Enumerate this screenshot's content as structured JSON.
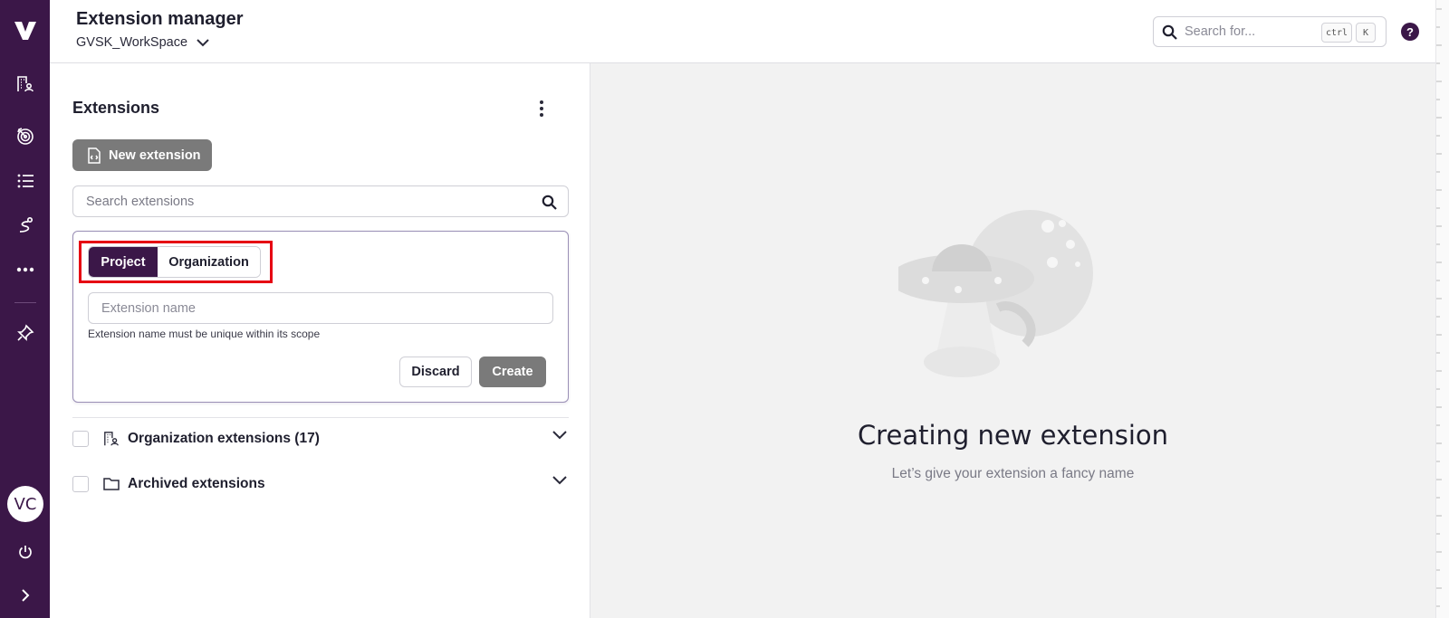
{
  "app": {
    "title": "Extension manager",
    "workspace": "GVSK_WorkSpace"
  },
  "rail": {
    "logo": "V",
    "items": [
      {
        "icon": "building-person-icon"
      },
      {
        "icon": "target-icon"
      },
      {
        "icon": "list-icon"
      },
      {
        "icon": "route-icon"
      },
      {
        "icon": "more-horizontal-icon"
      },
      {
        "icon": "pin-icon"
      }
    ],
    "avatar_initials": "VC",
    "power_icon": "power-icon",
    "expand_icon": "chevron-right-icon"
  },
  "header": {
    "search_placeholder": "Search for...",
    "shortcut_key_1": "ctrl",
    "shortcut_key_2": "K",
    "help_label": "?"
  },
  "panel": {
    "title": "Extensions",
    "new_button_label": "New extension",
    "search_placeholder": "Search extensions",
    "form": {
      "scope_options": [
        "Project",
        "Organization"
      ],
      "selected_scope": "Project",
      "name_placeholder": "Extension name",
      "hint": "Extension name must be unique within its scope",
      "discard_label": "Discard",
      "create_label": "Create"
    },
    "groups": [
      {
        "label": "Organization extensions (17)",
        "icon": "building-person-icon"
      },
      {
        "label": "Archived extensions",
        "icon": "folder-icon"
      }
    ]
  },
  "empty_state": {
    "title": "Creating new extension",
    "subtitle": "Let’s give your extension a fancy name"
  },
  "colors": {
    "rail_bg": "#3b1748",
    "accent": "#3b1748",
    "highlight": "#e60012",
    "disabled_button": "#7a7a7a"
  }
}
